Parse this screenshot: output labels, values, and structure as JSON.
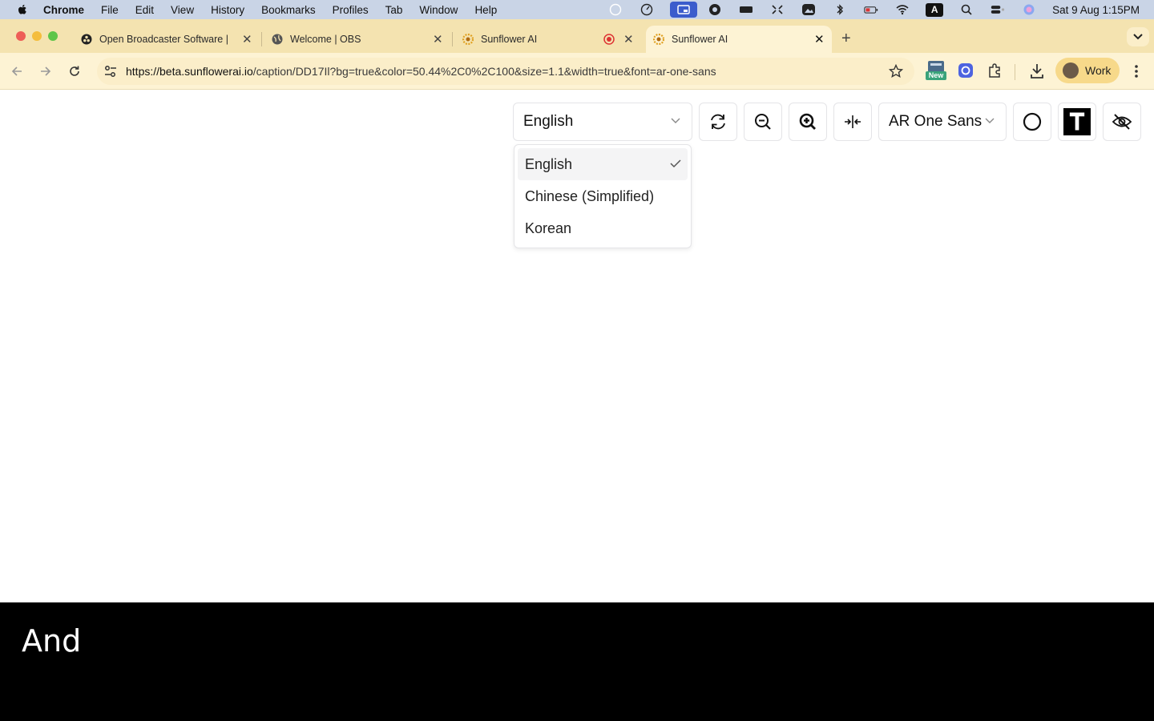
{
  "menubar": {
    "items": [
      "Chrome",
      "File",
      "Edit",
      "View",
      "History",
      "Bookmarks",
      "Profiles",
      "Tab",
      "Window",
      "Help"
    ],
    "clock": "Sat 9 Aug  1:15PM",
    "keyboard_letter": "A"
  },
  "tabs": [
    {
      "title": "Open Broadcaster Software |"
    },
    {
      "title": "Welcome | OBS"
    },
    {
      "title": "Sunflower AI"
    },
    {
      "title": "Sunflower AI"
    }
  ],
  "toolbar": {
    "url_domain": "https://beta.sunflowerai.io",
    "url_path": "/caption/DD17Il?bg=true&color=50.44%2C0%2C100&size=1.1&width=true&font=ar-one-sans",
    "profile_label": "Work",
    "ext_new_badge": "New"
  },
  "controls": {
    "language": "English",
    "font": "AR One Sans"
  },
  "dropdown": {
    "options": [
      "English",
      "Chinese (Simplified)",
      "Korean"
    ]
  },
  "caption": {
    "text": "And"
  },
  "colors": {
    "accent": "#f7d98a",
    "tabstrip": "#f4e3b0",
    "caption_bg": "#000000"
  }
}
